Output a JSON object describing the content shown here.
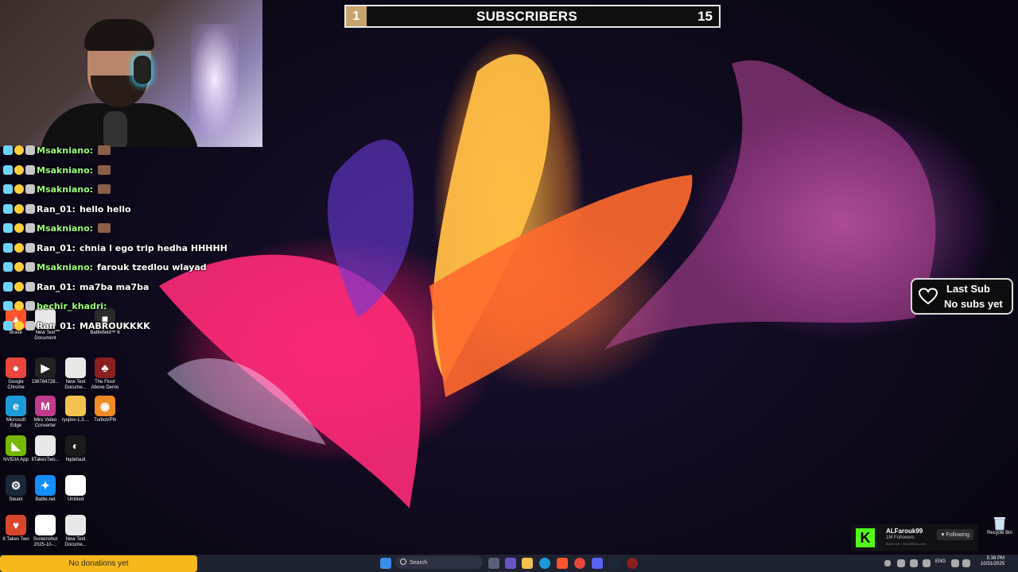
{
  "overlay": {
    "subscribers": {
      "rank": "1",
      "title": "SUBSCRIBERS",
      "count": "15"
    },
    "last_sub": {
      "title": "Last Sub",
      "value": "No subs yet"
    },
    "donations": "No donations yet"
  },
  "chat": [
    {
      "user": "Msakniano:",
      "message": "",
      "emote": true
    },
    {
      "user": "Msakniano:",
      "message": "",
      "emote": true
    },
    {
      "user": "Msakniano:",
      "message": "",
      "emote": true
    },
    {
      "user": "Ran_01:",
      "message": "hello hello",
      "emote": false
    },
    {
      "user": "Msakniano:",
      "message": "",
      "emote": true
    },
    {
      "user": "Ran_01:",
      "message": "chnia l ego trip hedha HHHHH",
      "emote": false
    },
    {
      "user": "Msakniano:",
      "message": "farouk tzedlou wlayad",
      "emote": false
    },
    {
      "user": "Ran_01:",
      "message": "ma7ba ma7ba",
      "emote": false
    },
    {
      "user": "bechir_khadri:",
      "message": "",
      "emote": false
    },
    {
      "user": "Ran_01:",
      "message": "MABROUKKKK",
      "emote": false
    }
  ],
  "desktop_icons": [
    {
      "label": "Brave",
      "color": "#fb542b",
      "glyph": "▲"
    },
    {
      "label": "New Text Document",
      "color": "#e8e8e8",
      "glyph": ""
    },
    {
      "label": "Battlefield™ 6",
      "color": "#2a2a2a",
      "glyph": "■"
    },
    {
      "label": "Google Chrome",
      "color": "#e8453c",
      "glyph": "●"
    },
    {
      "label": "138784728...",
      "color": "#222222",
      "glyph": "▶"
    },
    {
      "label": "New Text Docume...",
      "color": "#e8e8e8",
      "glyph": ""
    },
    {
      "label": "The Floor Above Demo",
      "color": "#8a1f1f",
      "glyph": "♣"
    },
    {
      "label": "Microsoft Edge",
      "color": "#1d9ad8",
      "glyph": "e"
    },
    {
      "label": "Miro Video Converter",
      "color": "#c23a8a",
      "glyph": "M"
    },
    {
      "label": "ryujinx-1.3....",
      "color": "#f2c14e",
      "glyph": ""
    },
    {
      "label": "TurboVPN",
      "color": "#f08a24",
      "glyph": "◉"
    },
    {
      "label": "NVIDIA App",
      "color": "#76b900",
      "glyph": "◣"
    },
    {
      "label": "ItTakesTwo...",
      "color": "#e8e8e8",
      "glyph": ""
    },
    {
      "label": "hqdefault",
      "color": "#1b1b1b",
      "glyph": "◐"
    },
    {
      "label": "Steam",
      "color": "#1b2838",
      "glyph": "⚙"
    },
    {
      "label": "Battle.net",
      "color": "#148eff",
      "glyph": "✦"
    },
    {
      "label": "Untitled",
      "color": "#ffffff",
      "glyph": ""
    },
    {
      "label": "It Takes Two",
      "color": "#d9462b",
      "glyph": "♥"
    },
    {
      "label": "Screenshot 2025-10-...",
      "color": "#ffffff",
      "glyph": "▪"
    },
    {
      "label": "New Text Docume...",
      "color": "#e8e8e8",
      "glyph": ""
    }
  ],
  "recycle_bin": "Recycle Bin",
  "kick": {
    "name": "ALFarouk99",
    "followers": "1M Followers",
    "made_with": "Made with VideoEffects.com",
    "follow_label": "♥ Following"
  },
  "taskbar": {
    "search_placeholder": "Search",
    "language": "ENG",
    "time": "5:38 PM",
    "date": "10/31/2025"
  }
}
